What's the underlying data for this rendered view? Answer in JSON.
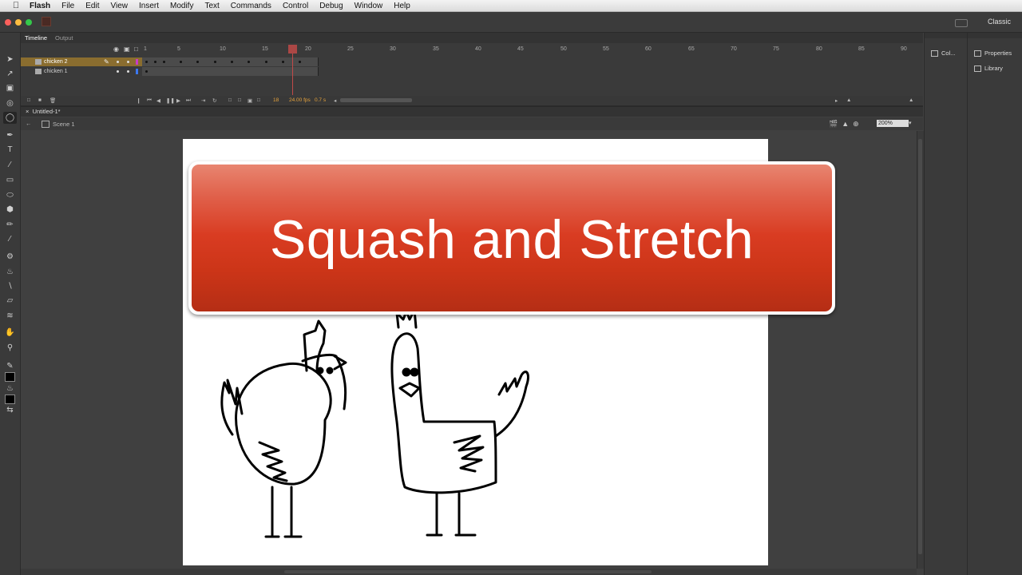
{
  "menubar": {
    "app": "Flash",
    "items": [
      "File",
      "Edit",
      "View",
      "Insert",
      "Modify",
      "Text",
      "Commands",
      "Control",
      "Debug",
      "Window",
      "Help"
    ]
  },
  "titlebar": {
    "workspace": "Classic"
  },
  "timeline": {
    "tabs": [
      "Timeline",
      "Output"
    ],
    "layers": [
      {
        "name": "chicken 2",
        "selected": true,
        "color": "#c83cc8"
      },
      {
        "name": "chicken 1",
        "selected": false,
        "color": "#3c78f0"
      }
    ],
    "frame_numbers": [
      "1",
      "5",
      "10",
      "15",
      "20",
      "25",
      "30",
      "35",
      "40",
      "45",
      "50",
      "55",
      "60",
      "65",
      "70",
      "75",
      "80",
      "85",
      "90"
    ],
    "current_frame": "18",
    "fps": "24.00 fps",
    "elapsed": "0.7 s"
  },
  "document": {
    "tab": "Untitled-1*",
    "scene": "Scene 1",
    "zoom": "200%"
  },
  "stage": {
    "banner_title": "Squash and Stretch"
  },
  "panels": {
    "color": "Col...",
    "properties": "Properties",
    "library": "Library"
  },
  "colors": {
    "banner_top": "#e88570",
    "banner_bottom": "#b52e15",
    "selected_layer": "#8a6d2f",
    "playhead": "#c04a48"
  }
}
